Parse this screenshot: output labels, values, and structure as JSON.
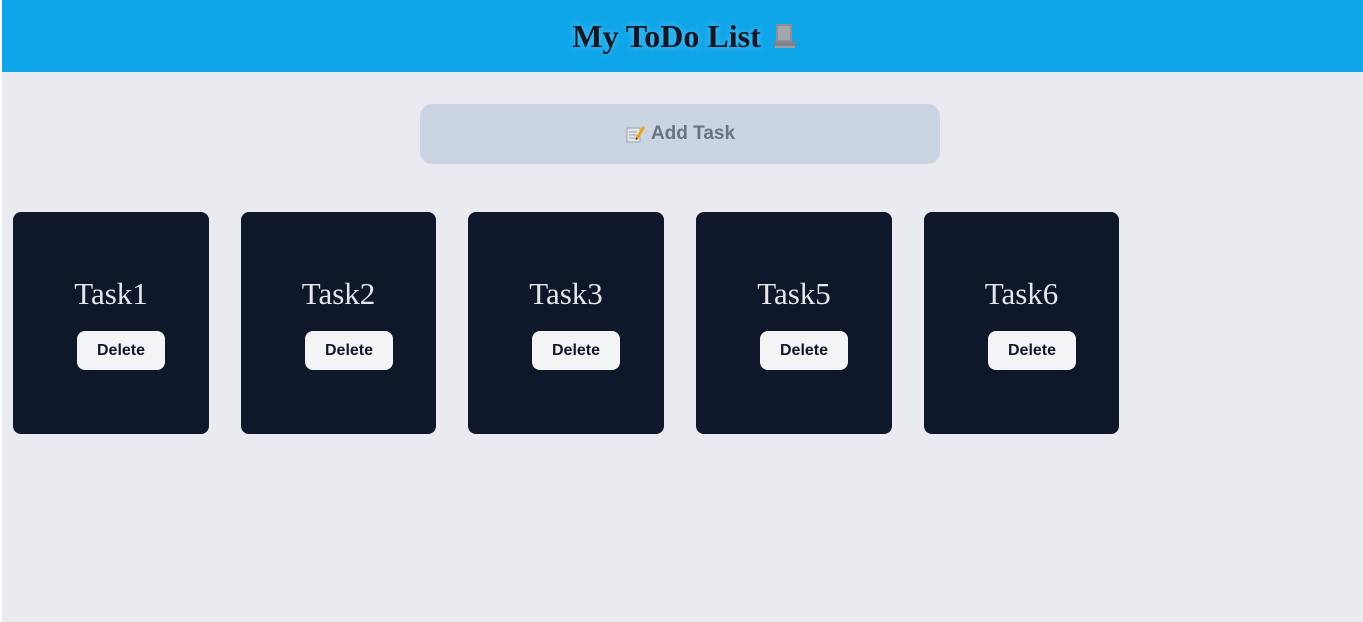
{
  "header": {
    "title": "My ToDo List",
    "icon": "computer-icon",
    "background": "#0ea5e9"
  },
  "add_task": {
    "icon": "memo-icon",
    "label": "Add Task"
  },
  "tasks": [
    {
      "label": "Task1",
      "delete_label": "Delete"
    },
    {
      "label": "Task2",
      "delete_label": "Delete"
    },
    {
      "label": "Task3",
      "delete_label": "Delete"
    },
    {
      "label": "Task5",
      "delete_label": "Delete"
    },
    {
      "label": "Task6",
      "delete_label": "Delete"
    }
  ],
  "colors": {
    "page_background": "#e9ebf0",
    "card_background": "#0f172a",
    "add_button_background": "#cbd5e1"
  }
}
